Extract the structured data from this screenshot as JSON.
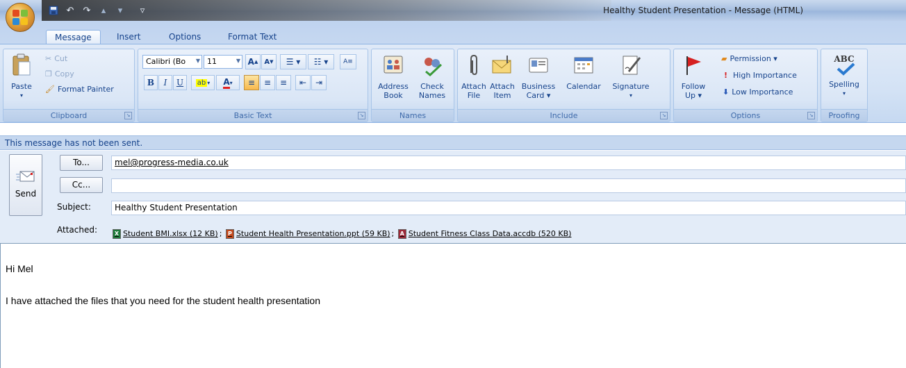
{
  "window": {
    "title": "Healthy Student Presentation - Message (HTML)",
    "quick_access": [
      "save-icon",
      "undo-icon",
      "redo-icon",
      "previous-icon",
      "next-icon",
      "customize-icon"
    ]
  },
  "tabs": [
    {
      "label": "Message",
      "active": true
    },
    {
      "label": "Insert",
      "active": false
    },
    {
      "label": "Options",
      "active": false
    },
    {
      "label": "Format Text",
      "active": false
    }
  ],
  "ribbon": {
    "clipboard": {
      "label": "Clipboard",
      "paste": "Paste",
      "cut": "Cut",
      "copy": "Copy",
      "format_painter": "Format Painter"
    },
    "basic_text": {
      "label": "Basic Text",
      "font_name": "Calibri (Bo",
      "font_size": "11",
      "bold": "B",
      "italic": "I",
      "underline": "U",
      "grow": "A",
      "shrink": "A"
    },
    "names": {
      "label": "Names",
      "address_book": [
        "Address",
        "Book"
      ],
      "check_names": [
        "Check",
        "Names"
      ]
    },
    "include": {
      "label": "Include",
      "attach_file": [
        "Attach",
        "File"
      ],
      "attach_item": [
        "Attach",
        "Item"
      ],
      "business_card": [
        "Business",
        "Card ▾"
      ],
      "calendar": "Calendar",
      "signature": "Signature"
    },
    "options": {
      "label": "Options",
      "follow_up": [
        "Follow",
        "Up ▾"
      ],
      "permission": "Permission ▾",
      "high_importance": "High Importance",
      "low_importance": "Low Importance"
    },
    "proofing": {
      "label": "Proofing",
      "spelling_icon_text": "ABC",
      "spelling": "Spelling"
    }
  },
  "infobar": "This message has not been sent.",
  "header": {
    "send": "Send",
    "to_button": "To...",
    "cc_button": "Cc...",
    "subject_label": "Subject:",
    "attached_label": "Attached:",
    "to_value": "mel@progress-media.co.uk",
    "cc_value": "",
    "subject_value": "Healthy Student Presentation",
    "attachments": [
      {
        "name": "Student BMI.xlsx (12 KB)",
        "icon": "excel-file-icon",
        "color": "#1d7a3a"
      },
      {
        "name": "Student Health Presentation.ppt (59 KB)",
        "icon": "powerpoint-file-icon",
        "color": "#c4491d"
      },
      {
        "name": "Student Fitness Class Data.accdb (520 KB)",
        "icon": "access-file-icon",
        "color": "#9c2a3a"
      }
    ]
  },
  "body": {
    "line1": "Hi Mel",
    "line2": "I have attached the files that you need for the student health presentation"
  }
}
